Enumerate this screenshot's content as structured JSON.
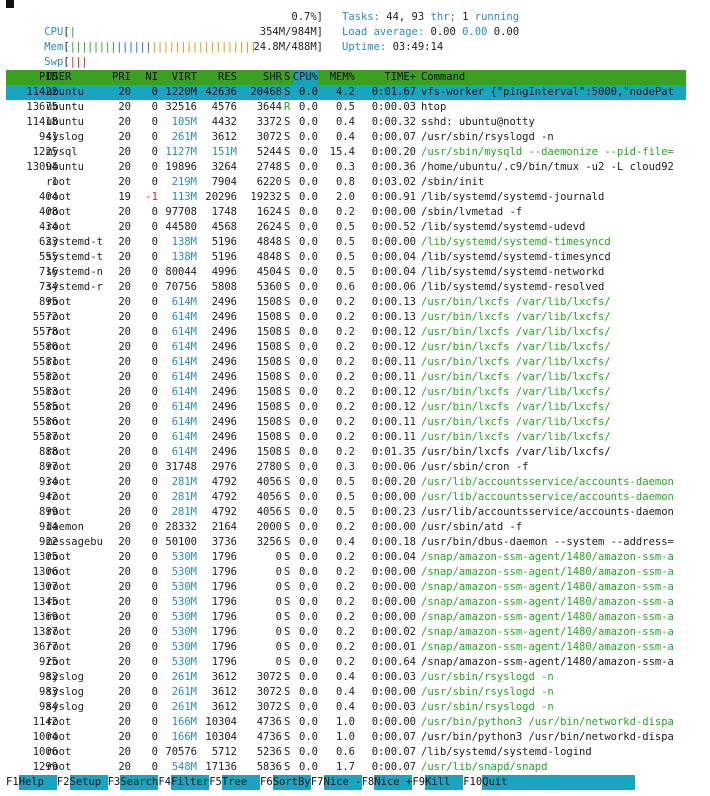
{
  "meters": {
    "cpu": {
      "label": "CPU",
      "value": "0.7%]"
    },
    "mem": {
      "label": "Mem",
      "value": "354M/984M]"
    },
    "swp": {
      "label": "Swp",
      "value": "24.8M/488M]"
    }
  },
  "stats": {
    "tasks_label": "Tasks: ",
    "tasks": "44, 93",
    "thr_label": " thr; ",
    "running": "1",
    "running_label": " running",
    "load_label": "Load average: ",
    "load1": "0.00",
    "load5": "0.00",
    "load15": "0.00",
    "uptime_label": "Uptime: ",
    "uptime": "03:49:14"
  },
  "columns": {
    "pid": "PID",
    "user": "USER",
    "pri": "PRI",
    "ni": "NI",
    "virt": "VIRT",
    "res": "RES",
    "shr": "SHR",
    "s": "S",
    "cpu": "CPU%",
    "mem": "MEM%",
    "time": "TIME+",
    "cmd": "Command"
  },
  "processes": [
    {
      "pid": "11422",
      "user": "ubuntu",
      "pri": "20",
      "ni": "0",
      "virt": "1220M",
      "res": "42636",
      "shr": "20468",
      "s": "S",
      "cpu": "0.0",
      "mem": "4.2",
      "time": "0:01.67",
      "cmd": "vfs-worker {\"pingInterval\":5000,\"nodePat",
      "t": false
    },
    {
      "pid": "13675",
      "user": "ubuntu",
      "pri": "20",
      "ni": "0",
      "virt": "32516",
      "res": "4576",
      "shr": "3644",
      "s": "R",
      "cpu": "0.0",
      "mem": "0.5",
      "time": "0:00.03",
      "cmd": "htop",
      "t": false
    },
    {
      "pid": "11418",
      "user": "ubuntu",
      "pri": "20",
      "ni": "0",
      "virt": "105M",
      "res": "4432",
      "shr": "3372",
      "s": "S",
      "cpu": "0.0",
      "mem": "0.4",
      "time": "0:00.32",
      "cmd": "sshd: ubuntu@notty",
      "t": false
    },
    {
      "pid": "941",
      "user": "syslog",
      "pri": "20",
      "ni": "0",
      "virt": "261M",
      "res": "3612",
      "shr": "3072",
      "s": "S",
      "cpu": "0.0",
      "mem": "0.4",
      "time": "0:00.07",
      "cmd": "/usr/sbin/rsyslogd -n",
      "t": false
    },
    {
      "pid": "1225",
      "user": "mysql",
      "pri": "20",
      "ni": "0",
      "virt": "1127M",
      "res": "151M",
      "shr": "5244",
      "s": "S",
      "cpu": "0.0",
      "mem": "15.4",
      "time": "0:00.20",
      "cmd": "/usr/sbin/mysqld --daemonize --pid-file=",
      "t": true
    },
    {
      "pid": "13094",
      "user": "ubuntu",
      "pri": "20",
      "ni": "0",
      "virt": "19896",
      "res": "3264",
      "shr": "2748",
      "s": "S",
      "cpu": "0.0",
      "mem": "0.3",
      "time": "0:00.36",
      "cmd": "/home/ubuntu/.c9/bin/tmux -u2 -L cloud92",
      "t": false
    },
    {
      "pid": "1",
      "user": "root",
      "pri": "20",
      "ni": "0",
      "virt": "219M",
      "res": "7904",
      "shr": "6220",
      "s": "S",
      "cpu": "0.0",
      "mem": "0.8",
      "time": "0:03.02",
      "cmd": "/sbin/init",
      "t": false
    },
    {
      "pid": "404",
      "user": "root",
      "pri": "19",
      "ni": "-1",
      "virt": "113M",
      "res": "20296",
      "shr": "19232",
      "s": "S",
      "cpu": "0.0",
      "mem": "2.0",
      "time": "0:00.91",
      "cmd": "/lib/systemd/systemd-journald",
      "t": false
    },
    {
      "pid": "408",
      "user": "root",
      "pri": "20",
      "ni": "0",
      "virt": "97708",
      "res": "1748",
      "shr": "1624",
      "s": "S",
      "cpu": "0.0",
      "mem": "0.2",
      "time": "0:00.00",
      "cmd": "/sbin/lvmetad -f",
      "t": false
    },
    {
      "pid": "434",
      "user": "root",
      "pri": "20",
      "ni": "0",
      "virt": "44580",
      "res": "4568",
      "shr": "2624",
      "s": "S",
      "cpu": "0.0",
      "mem": "0.5",
      "time": "0:00.52",
      "cmd": "/lib/systemd/systemd-udevd",
      "t": false
    },
    {
      "pid": "623",
      "user": "systemd-t",
      "pri": "20",
      "ni": "0",
      "virt": "138M",
      "res": "5196",
      "shr": "4848",
      "s": "S",
      "cpu": "0.0",
      "mem": "0.5",
      "time": "0:00.00",
      "cmd": "/lib/systemd/systemd-timesyncd",
      "t": true
    },
    {
      "pid": "555",
      "user": "systemd-t",
      "pri": "20",
      "ni": "0",
      "virt": "138M",
      "res": "5196",
      "shr": "4848",
      "s": "S",
      "cpu": "0.0",
      "mem": "0.5",
      "time": "0:00.04",
      "cmd": "/lib/systemd/systemd-timesyncd",
      "t": false
    },
    {
      "pid": "716",
      "user": "systemd-n",
      "pri": "20",
      "ni": "0",
      "virt": "80044",
      "res": "4996",
      "shr": "4504",
      "s": "S",
      "cpu": "0.0",
      "mem": "0.5",
      "time": "0:00.04",
      "cmd": "/lib/systemd/systemd-networkd",
      "t": false
    },
    {
      "pid": "734",
      "user": "systemd-r",
      "pri": "20",
      "ni": "0",
      "virt": "70756",
      "res": "5808",
      "shr": "5360",
      "s": "S",
      "cpu": "0.0",
      "mem": "0.6",
      "time": "0:00.06",
      "cmd": "/lib/systemd/systemd-resolved",
      "t": false
    },
    {
      "pid": "895",
      "user": "root",
      "pri": "20",
      "ni": "0",
      "virt": "614M",
      "res": "2496",
      "shr": "1508",
      "s": "S",
      "cpu": "0.0",
      "mem": "0.2",
      "time": "0:00.13",
      "cmd": "/usr/bin/lxcfs /var/lib/lxcfs/",
      "t": true
    },
    {
      "pid": "5572",
      "user": "root",
      "pri": "20",
      "ni": "0",
      "virt": "614M",
      "res": "2496",
      "shr": "1508",
      "s": "S",
      "cpu": "0.0",
      "mem": "0.2",
      "time": "0:00.13",
      "cmd": "/usr/bin/lxcfs /var/lib/lxcfs/",
      "t": true
    },
    {
      "pid": "5578",
      "user": "root",
      "pri": "20",
      "ni": "0",
      "virt": "614M",
      "res": "2496",
      "shr": "1508",
      "s": "S",
      "cpu": "0.0",
      "mem": "0.2",
      "time": "0:00.12",
      "cmd": "/usr/bin/lxcfs /var/lib/lxcfs/",
      "t": true
    },
    {
      "pid": "5580",
      "user": "root",
      "pri": "20",
      "ni": "0",
      "virt": "614M",
      "res": "2496",
      "shr": "1508",
      "s": "S",
      "cpu": "0.0",
      "mem": "0.2",
      "time": "0:00.12",
      "cmd": "/usr/bin/lxcfs /var/lib/lxcfs/",
      "t": true
    },
    {
      "pid": "5581",
      "user": "root",
      "pri": "20",
      "ni": "0",
      "virt": "614M",
      "res": "2496",
      "shr": "1508",
      "s": "S",
      "cpu": "0.0",
      "mem": "0.2",
      "time": "0:00.11",
      "cmd": "/usr/bin/lxcfs /var/lib/lxcfs/",
      "t": true
    },
    {
      "pid": "5582",
      "user": "root",
      "pri": "20",
      "ni": "0",
      "virt": "614M",
      "res": "2496",
      "shr": "1508",
      "s": "S",
      "cpu": "0.0",
      "mem": "0.2",
      "time": "0:00.11",
      "cmd": "/usr/bin/lxcfs /var/lib/lxcfs/",
      "t": true
    },
    {
      "pid": "5583",
      "user": "root",
      "pri": "20",
      "ni": "0",
      "virt": "614M",
      "res": "2496",
      "shr": "1508",
      "s": "S",
      "cpu": "0.0",
      "mem": "0.2",
      "time": "0:00.12",
      "cmd": "/usr/bin/lxcfs /var/lib/lxcfs/",
      "t": true
    },
    {
      "pid": "5585",
      "user": "root",
      "pri": "20",
      "ni": "0",
      "virt": "614M",
      "res": "2496",
      "shr": "1508",
      "s": "S",
      "cpu": "0.0",
      "mem": "0.2",
      "time": "0:00.12",
      "cmd": "/usr/bin/lxcfs /var/lib/lxcfs/",
      "t": true
    },
    {
      "pid": "5586",
      "user": "root",
      "pri": "20",
      "ni": "0",
      "virt": "614M",
      "res": "2496",
      "shr": "1508",
      "s": "S",
      "cpu": "0.0",
      "mem": "0.2",
      "time": "0:00.11",
      "cmd": "/usr/bin/lxcfs /var/lib/lxcfs/",
      "t": true
    },
    {
      "pid": "5587",
      "user": "root",
      "pri": "20",
      "ni": "0",
      "virt": "614M",
      "res": "2496",
      "shr": "1508",
      "s": "S",
      "cpu": "0.0",
      "mem": "0.2",
      "time": "0:00.11",
      "cmd": "/usr/bin/lxcfs /var/lib/lxcfs/",
      "t": true
    },
    {
      "pid": "888",
      "user": "root",
      "pri": "20",
      "ni": "0",
      "virt": "614M",
      "res": "2496",
      "shr": "1508",
      "s": "S",
      "cpu": "0.0",
      "mem": "0.2",
      "time": "0:01.35",
      "cmd": "/usr/bin/lxcfs /var/lib/lxcfs/",
      "t": false
    },
    {
      "pid": "897",
      "user": "root",
      "pri": "20",
      "ni": "0",
      "virt": "31748",
      "res": "2976",
      "shr": "2780",
      "s": "S",
      "cpu": "0.0",
      "mem": "0.3",
      "time": "0:00.06",
      "cmd": "/usr/sbin/cron -f",
      "t": false
    },
    {
      "pid": "934",
      "user": "root",
      "pri": "20",
      "ni": "0",
      "virt": "281M",
      "res": "4792",
      "shr": "4056",
      "s": "S",
      "cpu": "0.0",
      "mem": "0.5",
      "time": "0:00.20",
      "cmd": "/usr/lib/accountsservice/accounts-daemon",
      "t": true
    },
    {
      "pid": "942",
      "user": "root",
      "pri": "20",
      "ni": "0",
      "virt": "281M",
      "res": "4792",
      "shr": "4056",
      "s": "S",
      "cpu": "0.0",
      "mem": "0.5",
      "time": "0:00.00",
      "cmd": "/usr/lib/accountsservice/accounts-daemon",
      "t": true
    },
    {
      "pid": "899",
      "user": "root",
      "pri": "20",
      "ni": "0",
      "virt": "281M",
      "res": "4792",
      "shr": "4056",
      "s": "S",
      "cpu": "0.0",
      "mem": "0.5",
      "time": "0:00.23",
      "cmd": "/usr/lib/accountsservice/accounts-daemon",
      "t": false
    },
    {
      "pid": "914",
      "user": "daemon",
      "pri": "20",
      "ni": "0",
      "virt": "28332",
      "res": "2164",
      "shr": "2000",
      "s": "S",
      "cpu": "0.0",
      "mem": "0.2",
      "time": "0:00.00",
      "cmd": "/usr/sbin/atd -f",
      "t": false
    },
    {
      "pid": "922",
      "user": "messagebu",
      "pri": "20",
      "ni": "0",
      "virt": "50100",
      "res": "3736",
      "shr": "3256",
      "s": "S",
      "cpu": "0.0",
      "mem": "0.4",
      "time": "0:00.18",
      "cmd": "/usr/bin/dbus-daemon --system --address=",
      "t": false
    },
    {
      "pid": "1305",
      "user": "root",
      "pri": "20",
      "ni": "0",
      "virt": "530M",
      "res": "1796",
      "shr": "0",
      "s": "S",
      "cpu": "0.0",
      "mem": "0.2",
      "time": "0:00.04",
      "cmd": "/snap/amazon-ssm-agent/1480/amazon-ssm-a",
      "t": true
    },
    {
      "pid": "1306",
      "user": "root",
      "pri": "20",
      "ni": "0",
      "virt": "530M",
      "res": "1796",
      "shr": "0",
      "s": "S",
      "cpu": "0.0",
      "mem": "0.2",
      "time": "0:00.00",
      "cmd": "/snap/amazon-ssm-agent/1480/amazon-ssm-a",
      "t": true
    },
    {
      "pid": "1307",
      "user": "root",
      "pri": "20",
      "ni": "0",
      "virt": "530M",
      "res": "1796",
      "shr": "0",
      "s": "S",
      "cpu": "0.0",
      "mem": "0.2",
      "time": "0:00.00",
      "cmd": "/snap/amazon-ssm-agent/1480/amazon-ssm-a",
      "t": true
    },
    {
      "pid": "1345",
      "user": "root",
      "pri": "20",
      "ni": "0",
      "virt": "530M",
      "res": "1796",
      "shr": "0",
      "s": "S",
      "cpu": "0.0",
      "mem": "0.2",
      "time": "0:00.00",
      "cmd": "/snap/amazon-ssm-agent/1480/amazon-ssm-a",
      "t": true
    },
    {
      "pid": "1369",
      "user": "root",
      "pri": "20",
      "ni": "0",
      "virt": "530M",
      "res": "1796",
      "shr": "0",
      "s": "S",
      "cpu": "0.0",
      "mem": "0.2",
      "time": "0:00.00",
      "cmd": "/snap/amazon-ssm-agent/1480/amazon-ssm-a",
      "t": true
    },
    {
      "pid": "1387",
      "user": "root",
      "pri": "20",
      "ni": "0",
      "virt": "530M",
      "res": "1796",
      "shr": "0",
      "s": "S",
      "cpu": "0.0",
      "mem": "0.2",
      "time": "0:00.02",
      "cmd": "/snap/amazon-ssm-agent/1480/amazon-ssm-a",
      "t": true
    },
    {
      "pid": "3677",
      "user": "root",
      "pri": "20",
      "ni": "0",
      "virt": "530M",
      "res": "1796",
      "shr": "0",
      "s": "S",
      "cpu": "0.0",
      "mem": "0.2",
      "time": "0:00.01",
      "cmd": "/snap/amazon-ssm-agent/1480/amazon-ssm-a",
      "t": true
    },
    {
      "pid": "925",
      "user": "root",
      "pri": "20",
      "ni": "0",
      "virt": "530M",
      "res": "1796",
      "shr": "0",
      "s": "S",
      "cpu": "0.0",
      "mem": "0.2",
      "time": "0:00.64",
      "cmd": "/snap/amazon-ssm-agent/1480/amazon-ssm-a",
      "t": false
    },
    {
      "pid": "982",
      "user": "syslog",
      "pri": "20",
      "ni": "0",
      "virt": "261M",
      "res": "3612",
      "shr": "3072",
      "s": "S",
      "cpu": "0.0",
      "mem": "0.4",
      "time": "0:00.03",
      "cmd": "/usr/sbin/rsyslogd -n",
      "t": true
    },
    {
      "pid": "983",
      "user": "syslog",
      "pri": "20",
      "ni": "0",
      "virt": "261M",
      "res": "3612",
      "shr": "3072",
      "s": "S",
      "cpu": "0.0",
      "mem": "0.4",
      "time": "0:00.00",
      "cmd": "/usr/sbin/rsyslogd -n",
      "t": true
    },
    {
      "pid": "984",
      "user": "syslog",
      "pri": "20",
      "ni": "0",
      "virt": "261M",
      "res": "3612",
      "shr": "3072",
      "s": "S",
      "cpu": "0.0",
      "mem": "0.4",
      "time": "0:00.03",
      "cmd": "/usr/sbin/rsyslogd -n",
      "t": true
    },
    {
      "pid": "1142",
      "user": "root",
      "pri": "20",
      "ni": "0",
      "virt": "166M",
      "res": "10304",
      "shr": "4736",
      "s": "S",
      "cpu": "0.0",
      "mem": "1.0",
      "time": "0:00.00",
      "cmd": "/usr/bin/python3 /usr/bin/networkd-dispa",
      "t": true
    },
    {
      "pid": "1004",
      "user": "root",
      "pri": "20",
      "ni": "0",
      "virt": "166M",
      "res": "10304",
      "shr": "4736",
      "s": "S",
      "cpu": "0.0",
      "mem": "1.0",
      "time": "0:00.07",
      "cmd": "/usr/bin/python3 /usr/bin/networkd-dispa",
      "t": false
    },
    {
      "pid": "1006",
      "user": "root",
      "pri": "20",
      "ni": "0",
      "virt": "70576",
      "res": "5712",
      "shr": "5236",
      "s": "S",
      "cpu": "0.0",
      "mem": "0.6",
      "time": "0:00.07",
      "cmd": "/lib/systemd/systemd-logind",
      "t": false
    },
    {
      "pid": "1299",
      "user": "root",
      "pri": "20",
      "ni": "0",
      "virt": "548M",
      "res": "17136",
      "shr": "5836",
      "s": "S",
      "cpu": "0.0",
      "mem": "1.7",
      "time": "0:00.07",
      "cmd": "/usr/lib/snapd/snapd",
      "t": true
    }
  ],
  "fkeys": [
    {
      "key": "F1",
      "label": "Help  "
    },
    {
      "key": "F2",
      "label": "Setup "
    },
    {
      "key": "F3",
      "label": "Search"
    },
    {
      "key": "F4",
      "label": "Filter"
    },
    {
      "key": "F5",
      "label": "Tree  "
    },
    {
      "key": "F6",
      "label": "SortBy"
    },
    {
      "key": "F7",
      "label": "Nice -"
    },
    {
      "key": "F8",
      "label": "Nice +"
    },
    {
      "key": "F9",
      "label": "Kill  "
    },
    {
      "key": "F10",
      "label": "Quit                    "
    }
  ]
}
